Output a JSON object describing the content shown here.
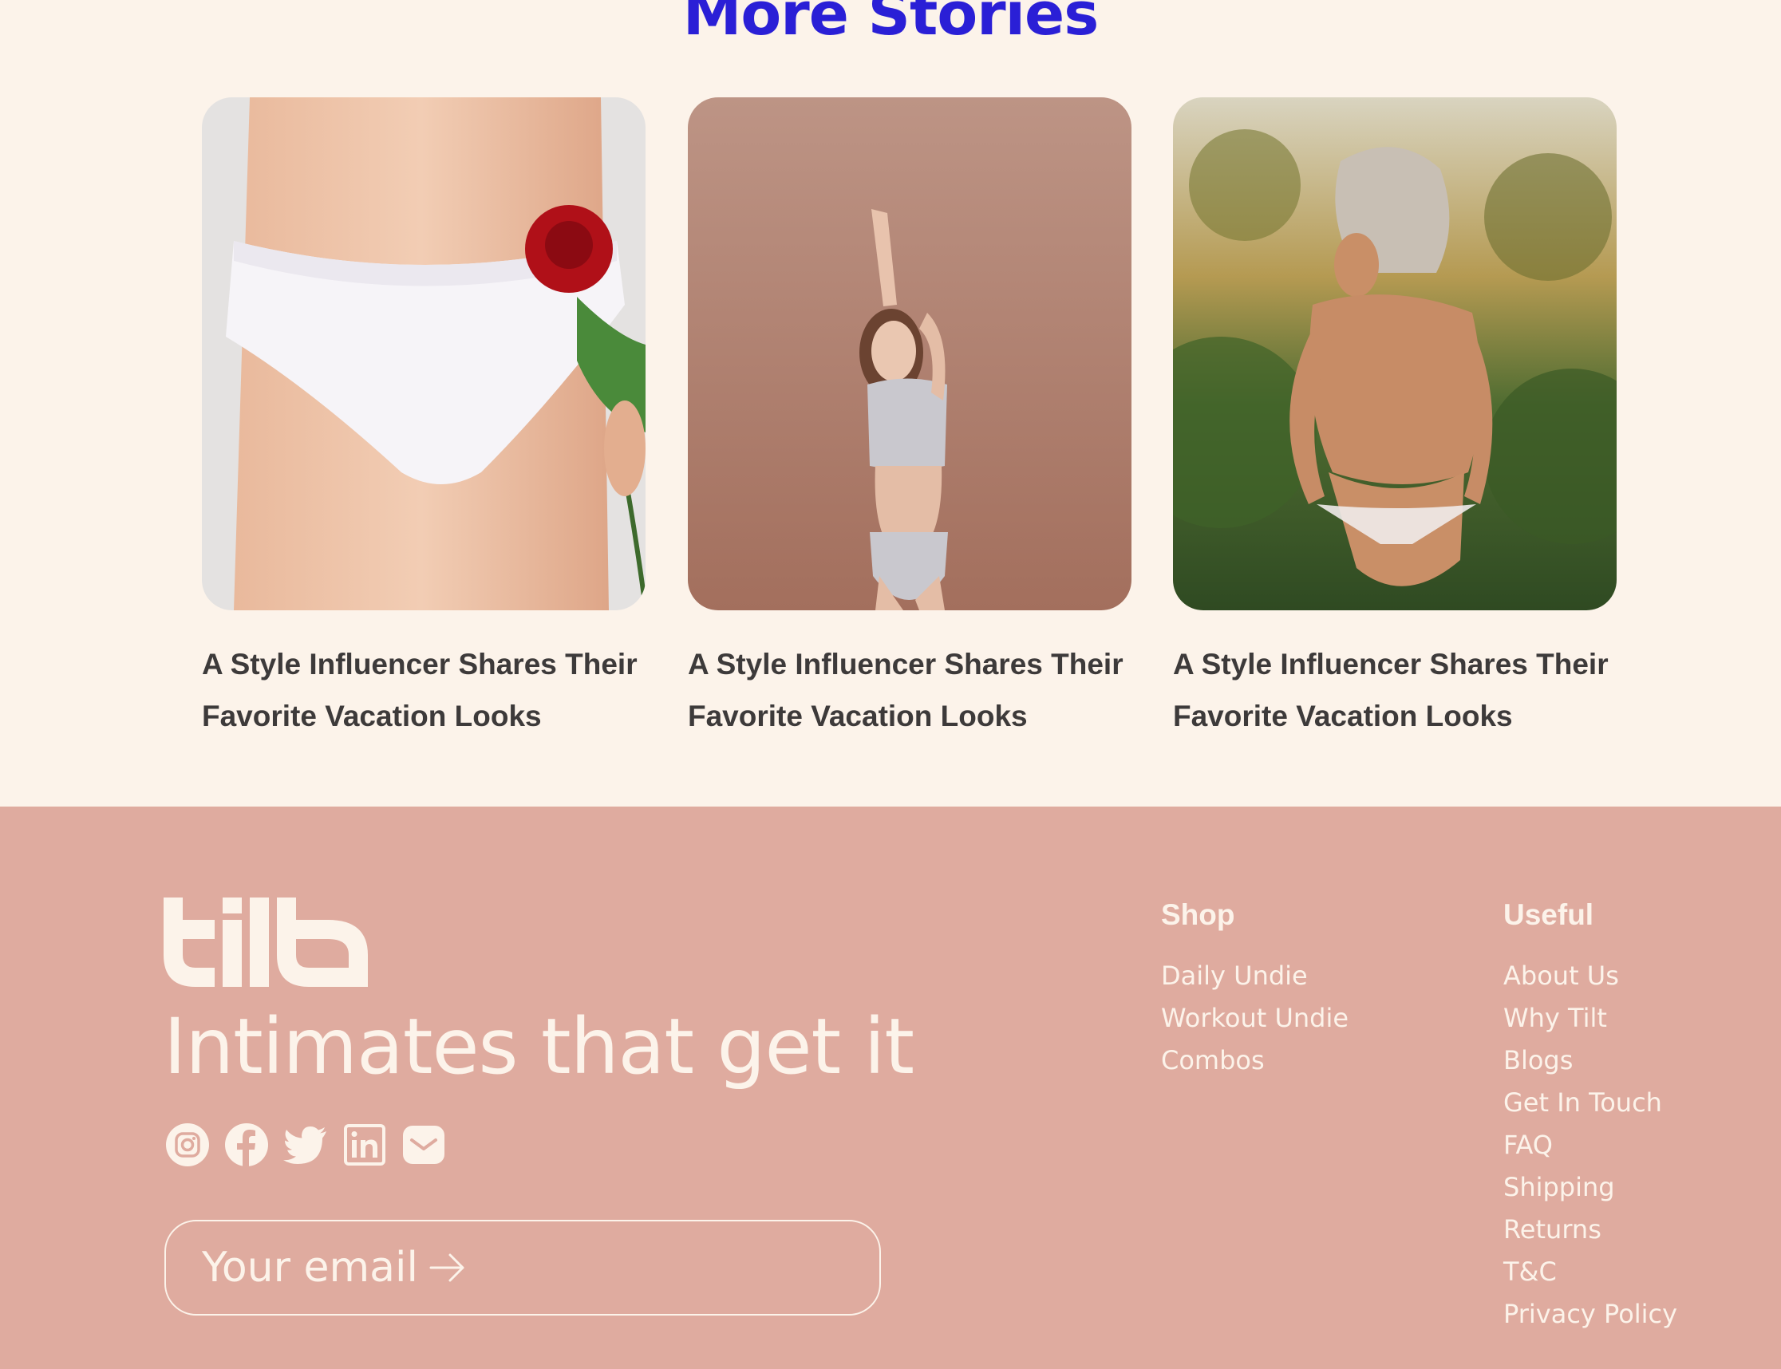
{
  "more_stories": {
    "title": "More Stories",
    "cards": [
      {
        "title": "A Style Influencer Shares Their Favorite Vacation Looks"
      },
      {
        "title": "A Style Influencer Shares Their Favorite Vacation Looks"
      },
      {
        "title": "A Style Influencer Shares Their Favorite Vacation Looks"
      }
    ]
  },
  "footer": {
    "logo_text": "tilt",
    "tagline": "Intimates that get it",
    "social_icons": [
      "instagram-icon",
      "facebook-icon",
      "twitter-icon",
      "linkedin-icon",
      "mail-icon"
    ],
    "email_placeholder": "Your email",
    "shop": {
      "heading": "Shop",
      "links": [
        "Daily Undie",
        "Workout Undie",
        "Combos"
      ]
    },
    "useful": {
      "heading": "Useful",
      "links": [
        "About Us",
        "Why Tilt",
        "Blogs",
        "Get In Touch",
        "FAQ",
        "Shipping",
        "Returns",
        "T&C",
        "Privacy Policy"
      ]
    }
  },
  "colors": {
    "page_bg": "#fcf3ea",
    "title_blue": "#2a1fd6",
    "footer_bg": "#dfab9f",
    "cream": "#fcf3ea",
    "caption_text": "#3d3a3a"
  }
}
